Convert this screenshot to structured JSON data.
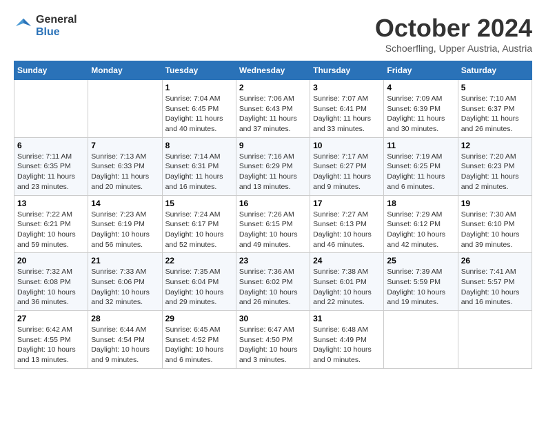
{
  "header": {
    "logo": {
      "general": "General",
      "blue": "Blue"
    },
    "month_title": "October 2024",
    "subtitle": "Schoerfling, Upper Austria, Austria"
  },
  "calendar": {
    "days_of_week": [
      "Sunday",
      "Monday",
      "Tuesday",
      "Wednesday",
      "Thursday",
      "Friday",
      "Saturday"
    ],
    "weeks": [
      [
        {
          "day": "",
          "sunrise": "",
          "sunset": "",
          "daylight": ""
        },
        {
          "day": "",
          "sunrise": "",
          "sunset": "",
          "daylight": ""
        },
        {
          "day": "1",
          "sunrise": "Sunrise: 7:04 AM",
          "sunset": "Sunset: 6:45 PM",
          "daylight": "Daylight: 11 hours and 40 minutes."
        },
        {
          "day": "2",
          "sunrise": "Sunrise: 7:06 AM",
          "sunset": "Sunset: 6:43 PM",
          "daylight": "Daylight: 11 hours and 37 minutes."
        },
        {
          "day": "3",
          "sunrise": "Sunrise: 7:07 AM",
          "sunset": "Sunset: 6:41 PM",
          "daylight": "Daylight: 11 hours and 33 minutes."
        },
        {
          "day": "4",
          "sunrise": "Sunrise: 7:09 AM",
          "sunset": "Sunset: 6:39 PM",
          "daylight": "Daylight: 11 hours and 30 minutes."
        },
        {
          "day": "5",
          "sunrise": "Sunrise: 7:10 AM",
          "sunset": "Sunset: 6:37 PM",
          "daylight": "Daylight: 11 hours and 26 minutes."
        }
      ],
      [
        {
          "day": "6",
          "sunrise": "Sunrise: 7:11 AM",
          "sunset": "Sunset: 6:35 PM",
          "daylight": "Daylight: 11 hours and 23 minutes."
        },
        {
          "day": "7",
          "sunrise": "Sunrise: 7:13 AM",
          "sunset": "Sunset: 6:33 PM",
          "daylight": "Daylight: 11 hours and 20 minutes."
        },
        {
          "day": "8",
          "sunrise": "Sunrise: 7:14 AM",
          "sunset": "Sunset: 6:31 PM",
          "daylight": "Daylight: 11 hours and 16 minutes."
        },
        {
          "day": "9",
          "sunrise": "Sunrise: 7:16 AM",
          "sunset": "Sunset: 6:29 PM",
          "daylight": "Daylight: 11 hours and 13 minutes."
        },
        {
          "day": "10",
          "sunrise": "Sunrise: 7:17 AM",
          "sunset": "Sunset: 6:27 PM",
          "daylight": "Daylight: 11 hours and 9 minutes."
        },
        {
          "day": "11",
          "sunrise": "Sunrise: 7:19 AM",
          "sunset": "Sunset: 6:25 PM",
          "daylight": "Daylight: 11 hours and 6 minutes."
        },
        {
          "day": "12",
          "sunrise": "Sunrise: 7:20 AM",
          "sunset": "Sunset: 6:23 PM",
          "daylight": "Daylight: 11 hours and 2 minutes."
        }
      ],
      [
        {
          "day": "13",
          "sunrise": "Sunrise: 7:22 AM",
          "sunset": "Sunset: 6:21 PM",
          "daylight": "Daylight: 10 hours and 59 minutes."
        },
        {
          "day": "14",
          "sunrise": "Sunrise: 7:23 AM",
          "sunset": "Sunset: 6:19 PM",
          "daylight": "Daylight: 10 hours and 56 minutes."
        },
        {
          "day": "15",
          "sunrise": "Sunrise: 7:24 AM",
          "sunset": "Sunset: 6:17 PM",
          "daylight": "Daylight: 10 hours and 52 minutes."
        },
        {
          "day": "16",
          "sunrise": "Sunrise: 7:26 AM",
          "sunset": "Sunset: 6:15 PM",
          "daylight": "Daylight: 10 hours and 49 minutes."
        },
        {
          "day": "17",
          "sunrise": "Sunrise: 7:27 AM",
          "sunset": "Sunset: 6:13 PM",
          "daylight": "Daylight: 10 hours and 46 minutes."
        },
        {
          "day": "18",
          "sunrise": "Sunrise: 7:29 AM",
          "sunset": "Sunset: 6:12 PM",
          "daylight": "Daylight: 10 hours and 42 minutes."
        },
        {
          "day": "19",
          "sunrise": "Sunrise: 7:30 AM",
          "sunset": "Sunset: 6:10 PM",
          "daylight": "Daylight: 10 hours and 39 minutes."
        }
      ],
      [
        {
          "day": "20",
          "sunrise": "Sunrise: 7:32 AM",
          "sunset": "Sunset: 6:08 PM",
          "daylight": "Daylight: 10 hours and 36 minutes."
        },
        {
          "day": "21",
          "sunrise": "Sunrise: 7:33 AM",
          "sunset": "Sunset: 6:06 PM",
          "daylight": "Daylight: 10 hours and 32 minutes."
        },
        {
          "day": "22",
          "sunrise": "Sunrise: 7:35 AM",
          "sunset": "Sunset: 6:04 PM",
          "daylight": "Daylight: 10 hours and 29 minutes."
        },
        {
          "day": "23",
          "sunrise": "Sunrise: 7:36 AM",
          "sunset": "Sunset: 6:02 PM",
          "daylight": "Daylight: 10 hours and 26 minutes."
        },
        {
          "day": "24",
          "sunrise": "Sunrise: 7:38 AM",
          "sunset": "Sunset: 6:01 PM",
          "daylight": "Daylight: 10 hours and 22 minutes."
        },
        {
          "day": "25",
          "sunrise": "Sunrise: 7:39 AM",
          "sunset": "Sunset: 5:59 PM",
          "daylight": "Daylight: 10 hours and 19 minutes."
        },
        {
          "day": "26",
          "sunrise": "Sunrise: 7:41 AM",
          "sunset": "Sunset: 5:57 PM",
          "daylight": "Daylight: 10 hours and 16 minutes."
        }
      ],
      [
        {
          "day": "27",
          "sunrise": "Sunrise: 6:42 AM",
          "sunset": "Sunset: 4:55 PM",
          "daylight": "Daylight: 10 hours and 13 minutes."
        },
        {
          "day": "28",
          "sunrise": "Sunrise: 6:44 AM",
          "sunset": "Sunset: 4:54 PM",
          "daylight": "Daylight: 10 hours and 9 minutes."
        },
        {
          "day": "29",
          "sunrise": "Sunrise: 6:45 AM",
          "sunset": "Sunset: 4:52 PM",
          "daylight": "Daylight: 10 hours and 6 minutes."
        },
        {
          "day": "30",
          "sunrise": "Sunrise: 6:47 AM",
          "sunset": "Sunset: 4:50 PM",
          "daylight": "Daylight: 10 hours and 3 minutes."
        },
        {
          "day": "31",
          "sunrise": "Sunrise: 6:48 AM",
          "sunset": "Sunset: 4:49 PM",
          "daylight": "Daylight: 10 hours and 0 minutes."
        },
        {
          "day": "",
          "sunrise": "",
          "sunset": "",
          "daylight": ""
        },
        {
          "day": "",
          "sunrise": "",
          "sunset": "",
          "daylight": ""
        }
      ]
    ]
  }
}
